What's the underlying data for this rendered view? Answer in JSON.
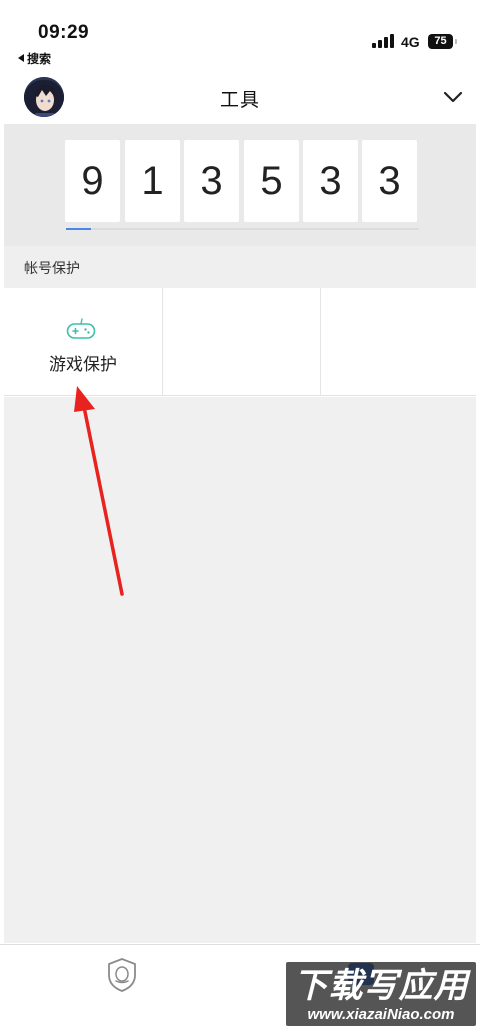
{
  "status_bar": {
    "time": "09:29",
    "back_app": "搜索",
    "network": "4G",
    "battery": "75"
  },
  "header": {
    "title": "工具",
    "avatar_icon": "anime-avatar",
    "menu_icon": "chevron-down-icon"
  },
  "code": {
    "digits": [
      "9",
      "1",
      "3",
      "5",
      "3",
      "3"
    ],
    "countdown_progress": 0.07,
    "accent_color": "#4a86e8"
  },
  "account_section": {
    "label": "帐号保护",
    "items": [
      {
        "label": "游戏保护",
        "icon": "gamepad-icon",
        "icon_color": "#3dbfa8"
      },
      {
        "label": ""
      },
      {
        "label": ""
      }
    ]
  },
  "annotation": {
    "arrow_color": "#e8231f"
  },
  "tab_bar": {
    "items": [
      {
        "icon": "qq-shield-icon"
      },
      {
        "icon": "tools-tab-icon"
      }
    ]
  },
  "watermark": {
    "title": "下载写应用",
    "url": "www.xiazaiNiao.com"
  }
}
